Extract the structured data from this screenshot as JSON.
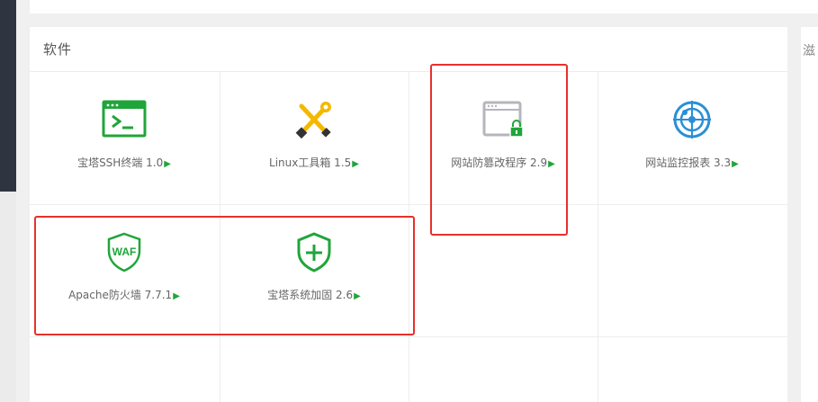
{
  "panel": {
    "title": "软件"
  },
  "right_panel": {
    "title": "滋"
  },
  "apps": [
    {
      "name": "宝塔SSH终端",
      "version": "1.0",
      "icon": "terminal-icon"
    },
    {
      "name": "Linux工具箱",
      "version": "1.5",
      "icon": "tools-icon"
    },
    {
      "name": "网站防篡改程序",
      "version": "2.9",
      "icon": "browser-lock-icon"
    },
    {
      "name": "网站监控报表",
      "version": "3.3",
      "icon": "radar-icon"
    },
    {
      "name": "Apache防火墙",
      "version": "7.7.1",
      "icon": "waf-shield-icon"
    },
    {
      "name": "宝塔系统加固",
      "version": "2.6",
      "icon": "shield-plus-icon"
    }
  ],
  "labels": {
    "app0": "宝塔SSH终端 1.0",
    "app1": "Linux工具箱 1.5",
    "app2": "网站防篡改程序 2.9",
    "app3": "网站监控报表 3.3",
    "app4": "Apache防火墙 7.7.1",
    "app5": "宝塔系统加固 2.6"
  },
  "icon_text": {
    "waf": "WAF"
  },
  "arrow_glyph": "▶",
  "colors": {
    "accent": "#20a53a",
    "highlight": "#e8302c",
    "tools": "#f5b800",
    "radar": "#2a8fd6"
  }
}
